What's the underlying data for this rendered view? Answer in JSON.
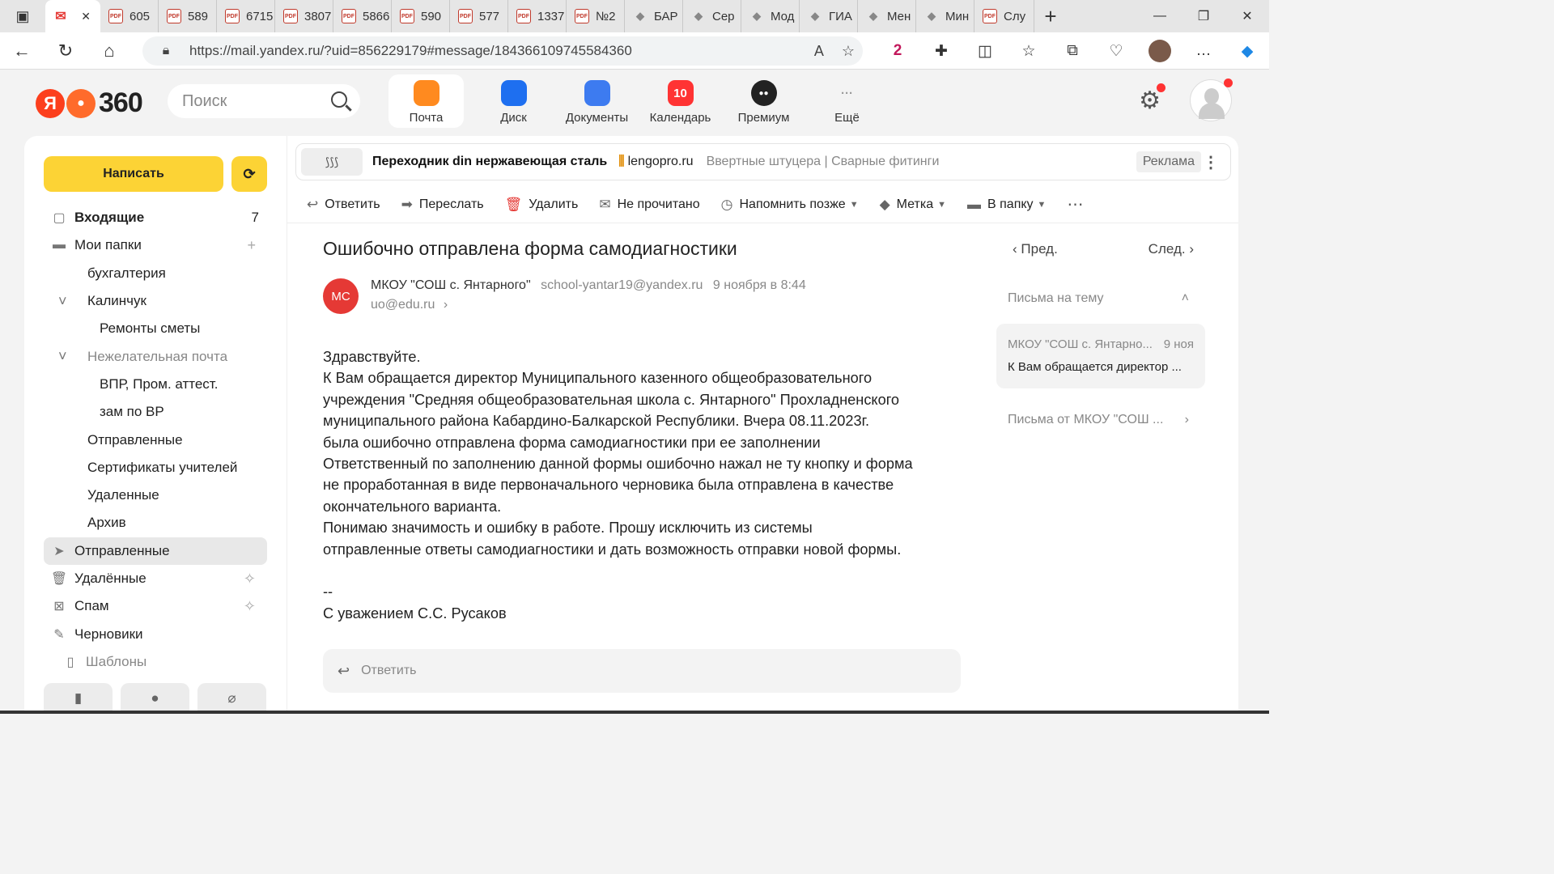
{
  "browser": {
    "tabs": [
      {
        "label": "",
        "icon": "mail-icon",
        "active": true
      },
      {
        "label": "605",
        "icon": "pdf-icon"
      },
      {
        "label": "589",
        "icon": "pdf-icon"
      },
      {
        "label": "6715",
        "icon": "pdf-icon"
      },
      {
        "label": "3807",
        "icon": "pdf-icon"
      },
      {
        "label": "5866",
        "icon": "pdf-icon"
      },
      {
        "label": "590",
        "icon": "pdf-icon"
      },
      {
        "label": "577",
        "icon": "pdf-icon"
      },
      {
        "label": "1337",
        "icon": "pdf-icon"
      },
      {
        "label": "№2",
        "icon": "pdf-icon"
      },
      {
        "label": "БАР",
        "icon": "book-icon"
      },
      {
        "label": "Сер",
        "icon": "hat-icon"
      },
      {
        "label": "Мод",
        "icon": "puzzle-icon"
      },
      {
        "label": "ГИА",
        "icon": "grad-cap-icon"
      },
      {
        "label": "Мен",
        "icon": "puzzle-icon"
      },
      {
        "label": "Мин",
        "icon": "emblem-icon"
      },
      {
        "label": "Слу",
        "icon": "pdf-icon"
      }
    ],
    "url": "https://mail.yandex.ru/?uid=856229179#message/184366109745584360"
  },
  "header": {
    "search_placeholder": "Поиск",
    "logo_text": "360",
    "services": [
      {
        "label": "Почта",
        "color": "#ff8a1f",
        "icon": "mail-icon"
      },
      {
        "label": "Диск",
        "color": "#1e6ff0",
        "icon": "disk-icon"
      },
      {
        "label": "Документы",
        "color": "#3d7bf0",
        "icon": "docs-icon"
      },
      {
        "label": "Календарь",
        "color": "#f33",
        "icon": "calendar-icon",
        "badge": "10"
      },
      {
        "label": "Премиум",
        "color": "#222",
        "icon": "premium-icon"
      },
      {
        "label": "Ещё",
        "color": "#bbb",
        "icon": "more-icon"
      }
    ]
  },
  "sidebar": {
    "compose_label": "Написать",
    "folders": [
      {
        "label": "Входящие",
        "count": "7",
        "icon": "inbox-icon",
        "bold": true,
        "indent": 0
      },
      {
        "label": "Мои папки",
        "icon": "folder-icon",
        "action": "+",
        "indent": 0
      },
      {
        "label": "бухгалтерия",
        "indent": 1
      },
      {
        "label": "Калинчук",
        "indent": 1,
        "chevron": true
      },
      {
        "label": "Ремонты сметы",
        "indent": 2
      },
      {
        "label": "Нежелательная почта",
        "indent": 1,
        "chevron": true,
        "muted": true
      },
      {
        "label": "ВПР, Пром. аттест.",
        "indent": 2
      },
      {
        "label": "зам по ВР",
        "indent": 2
      },
      {
        "label": "Отправленные",
        "indent": 1
      },
      {
        "label": "Сертификаты учителей",
        "indent": 1
      },
      {
        "label": "Удаленные",
        "indent": 1
      },
      {
        "label": "Архив",
        "indent": 1
      },
      {
        "label": "Отправленные",
        "icon": "sent-icon",
        "indent": 0,
        "active": true
      },
      {
        "label": "Удалённые",
        "icon": "trash-icon",
        "indent": 0,
        "action": "broom"
      },
      {
        "label": "Спам",
        "icon": "spam-icon",
        "indent": 0,
        "action": "broom"
      },
      {
        "label": "Черновики",
        "icon": "drafts-icon",
        "indent": 0
      },
      {
        "label": "Шаблоны",
        "icon": "template-icon",
        "indent": 1,
        "muted": true
      }
    ]
  },
  "ad": {
    "title": "Переходник din нержавеющая сталь",
    "brand": "lengopro.ru",
    "links": "Ввертные штуцера | Сварные фитинги",
    "label": "Реклама"
  },
  "toolbar": {
    "reply": "Ответить",
    "forward": "Переслать",
    "delete": "Удалить",
    "unread": "Не прочитано",
    "remind": "Напомнить позже",
    "label": "Метка",
    "move": "В папку"
  },
  "message": {
    "subject": "Ошибочно отправлена форма самодиагностики",
    "avatar_initials": "МС",
    "sender_name": "МКОУ \"СОШ с. Янтарного\"",
    "sender_email": "school-yantar19@yandex.ru",
    "date": "9 ноября в 8:44",
    "to": "uo@edu.ru",
    "body_lines": [
      "Здравствуйте.",
      "К  Вам обращается директор Муниципального казенного общеобразовательного",
      "учреждения \"Средняя общеобразовательная школа с. Янтарного\" Прохладненского",
      "муниципального района Кабардино-Балкарской Республики. Вчера 08.11.2023г.",
      "была ошибочно отправлена форма самодиагностики  при ее заполнении",
      "Ответственный по заполнению данной формы ошибочно нажал не ту кнопку и форма",
      "не проработанная в виде первоначального черновика была отправлена в качестве",
      "окончательного варианта.",
      "Понимаю значимость и ошибку в работе. Прошу исключить из системы",
      "отправленные ответы самодиагностики и дать возможность отправки новой формы.",
      "",
      "--",
      "С уважением С.С. Русаков"
    ],
    "quick_reply": "Ответить"
  },
  "rightpane": {
    "prev": "Пред.",
    "next": "След.",
    "thread_header": "Письма на тему",
    "thread_from": "МКОУ \"СОШ с. Янтарно...",
    "thread_date": "9 ноя",
    "thread_preview": "К Вам обращается директор ...",
    "from_more": "Письма от МКОУ \"СОШ ..."
  }
}
